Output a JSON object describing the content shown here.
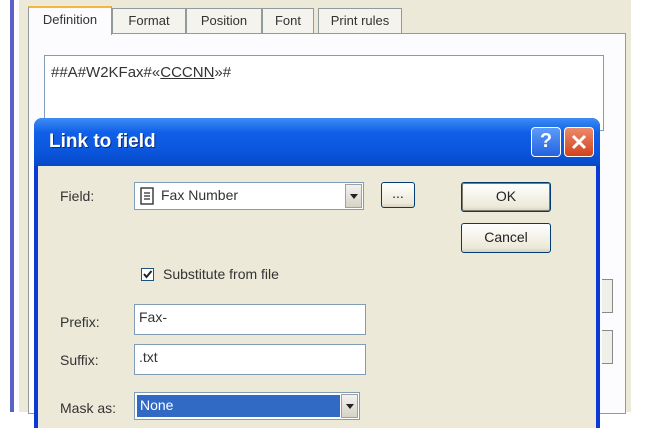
{
  "background": {
    "tabs": [
      "Definition",
      "Format",
      "Position",
      "Font",
      "Print rules"
    ],
    "active_tab": "Definition",
    "editor_prefix": "##A#W2KFax#«",
    "editor_field": "CCCNN",
    "editor_suffix": "»#"
  },
  "dialog": {
    "title": "Link to field",
    "help_label": "?",
    "field_label": "Field:",
    "field_value": "Fax Number",
    "browse_label": "...",
    "substitute_label": "Substitute from file",
    "substitute_checked": true,
    "prefix_label": "Prefix:",
    "prefix_value": "Fax-",
    "suffix_label": "Suffix:",
    "suffix_value": ".txt",
    "mask_label": "Mask as:",
    "mask_value": "None",
    "ok_label": "OK",
    "cancel_label": "Cancel"
  },
  "colors": {
    "titlebar": "#0a55dc",
    "selection": "#316ac5",
    "dialog_face": "#ece9d8"
  }
}
